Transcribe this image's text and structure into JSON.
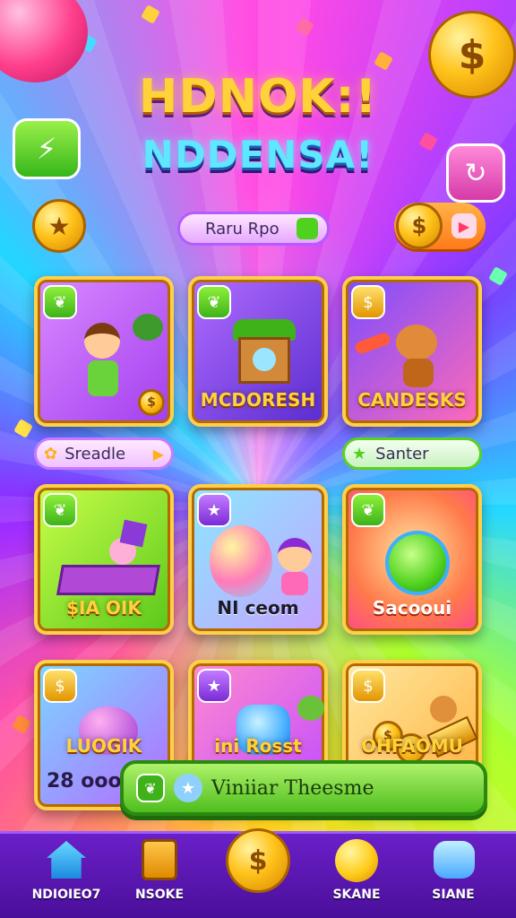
{
  "header": {
    "title_line1": "HDNOK:!",
    "title_line2": "NDDENSA!"
  },
  "top_bar": {
    "pill_label": "Raru Rpo",
    "coin_button_icon": "coin-icon",
    "arrow_icon": "play-arrow-icon"
  },
  "grid": {
    "row1": [
      {
        "label": "",
        "badge_icon": "leaf-icon"
      },
      {
        "label": "MCDORESH",
        "badge_icon": "leaf-icon"
      },
      {
        "label": "CANDESKS",
        "badge_icon": "coin-icon"
      }
    ],
    "row1_pills": {
      "left_label": "Sreadle",
      "right_label": "Santer"
    },
    "row2": [
      {
        "label": "$IA OIK",
        "badge_icon": "leaf-icon"
      },
      {
        "label": "NI ceom",
        "badge_icon": "star-icon"
      },
      {
        "label": "Sacooui",
        "badge_icon": "leaf-icon"
      }
    ],
    "row3": [
      {
        "label": "LUOGIK",
        "badge_icon": "coin-icon"
      },
      {
        "label": "ini Rosst",
        "badge_icon": "star-icon"
      },
      {
        "label": "OHFAOMU",
        "badge_icon": "coin-icon"
      }
    ],
    "row3_left_count": "28 ooo"
  },
  "banner": {
    "label": "Viniiar Theesme"
  },
  "bottom_nav": [
    {
      "label": "NDIOIEO7",
      "icon": "home-icon"
    },
    {
      "label": "NSOKE",
      "icon": "clipboard-icon"
    },
    {
      "label": "",
      "icon": "coin-icon"
    },
    {
      "label": "SKANE",
      "icon": "ball-icon"
    },
    {
      "label": "SIANE",
      "icon": "gem-icon"
    }
  ],
  "colors": {
    "accent_gold": "#ffd23a",
    "accent_green": "#5ad21e",
    "nav_bg": "#5a18b4"
  }
}
